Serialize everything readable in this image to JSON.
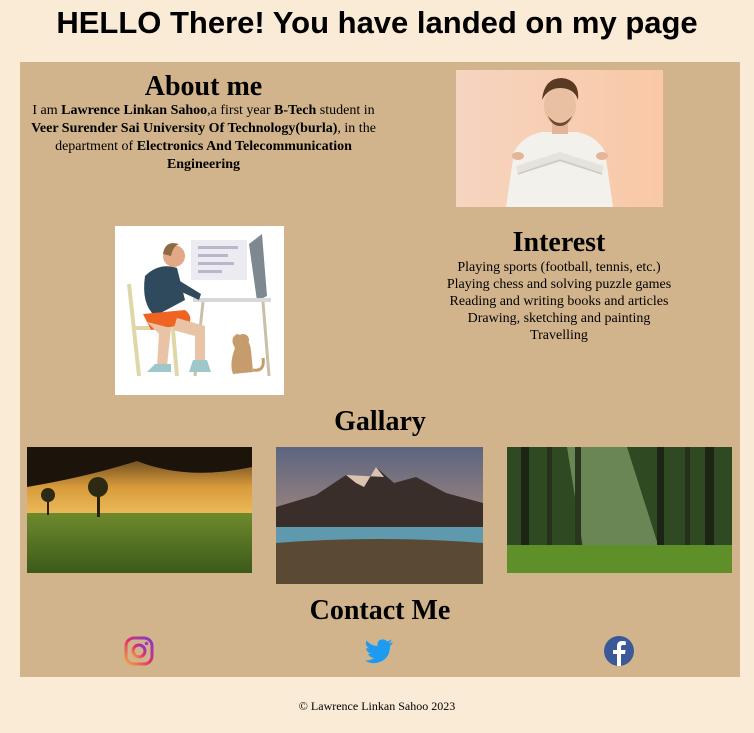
{
  "page": {
    "title": "HELLO There! You have landed on my page"
  },
  "about": {
    "heading": "About me",
    "t1": "I am ",
    "name": "Lawrence Linkan Sahoo",
    "t2": ",a first year ",
    "degree": "B-Tech",
    "t3": " student in ",
    "university": "Veer Surender Sai University Of Technology(burla)",
    "t4": ", in the department of ",
    "department": "Electronics And Telecommunication Engineering"
  },
  "interest": {
    "heading": "Interest",
    "items": [
      "Playing sports (football, tennis, etc.)",
      "Playing chess and solving puzzle games",
      "Reading and writing books and articles",
      "Drawing, sketching and painting",
      "Travelling"
    ]
  },
  "gallery": {
    "heading": "Gallary"
  },
  "contact": {
    "heading": "Contact Me",
    "icons": [
      "instagram-icon",
      "twitter-icon",
      "facebook-icon"
    ]
  },
  "footer": {
    "text": "© Lawrence Linkan Sahoo 2023"
  },
  "colors": {
    "page_bg": "#faebd7",
    "main_bg": "#d2b48c",
    "twitter": "#1d9bf0",
    "facebook": "#3b5998"
  }
}
